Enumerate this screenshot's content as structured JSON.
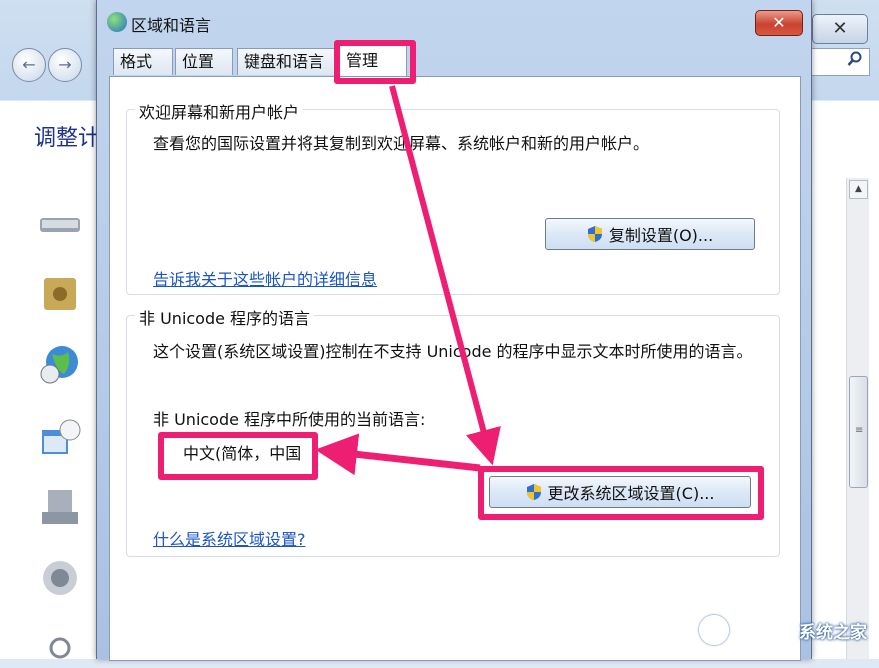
{
  "background": {
    "heading": "调整计",
    "close_glyph": "✕",
    "back_glyph": "←",
    "forward_glyph": "→",
    "search_icon": "search-icon",
    "scroll_up_glyph": "▲",
    "scroll_grip_glyph": "≡"
  },
  "dialog": {
    "title": "区域和语言",
    "close_glyph": "✕",
    "tabs": [
      {
        "label": "格式",
        "active": false
      },
      {
        "label": "位置",
        "active": false
      },
      {
        "label": "键盘和语言",
        "active": false
      },
      {
        "label": "管理",
        "active": true
      }
    ],
    "welcome_group": {
      "title": "欢迎屏幕和新用户帐户",
      "description": "查看您的国际设置并将其复制到欢迎屏幕、系统帐户和新的用户帐户。",
      "copy_button": "复制设置(O)...",
      "link": "告诉我关于这些帐户的详细信息"
    },
    "unicode_group": {
      "title": "非 Unicode 程序的语言",
      "description": "这个设置(系统区域设置)控制在不支持 Unicode 的程序中显示文本时所使用的语言。",
      "current_label": "非 Unicode 程序中所使用的当前语言:",
      "current_value": "中文(简体，中国",
      "change_button": "更改系统区域设置(C)...",
      "link": "什么是系统区域设置?"
    }
  },
  "watermark": "系统之家",
  "colors": {
    "highlight": "#ee1f72",
    "link": "#1a55c4",
    "close_button": "#c94330"
  }
}
